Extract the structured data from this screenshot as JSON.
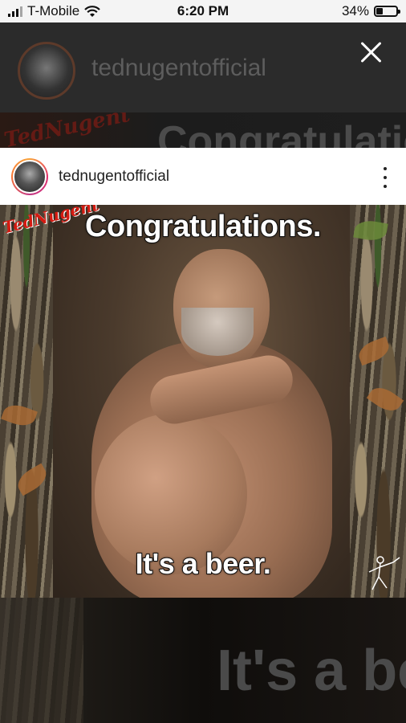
{
  "status_bar": {
    "carrier": "T-Mobile",
    "time": "6:20 PM",
    "battery": "34%",
    "battery_level": 0.34
  },
  "story_background": {
    "username": "tednugentofficial",
    "watermark": "TedNugent",
    "image_text_top": "Congratulations.",
    "image_text_bottom": "It's a beer"
  },
  "post": {
    "username": "tednugentofficial",
    "more_icon": "more-vertical-icon",
    "image": {
      "watermark": "TedNugent",
      "caption_top": "Congratulations.",
      "caption_bottom": "It's a beer."
    }
  },
  "icons": {
    "close": "close-icon",
    "wifi": "wifi-icon",
    "signal": "signal-icon",
    "battery": "battery-icon"
  }
}
